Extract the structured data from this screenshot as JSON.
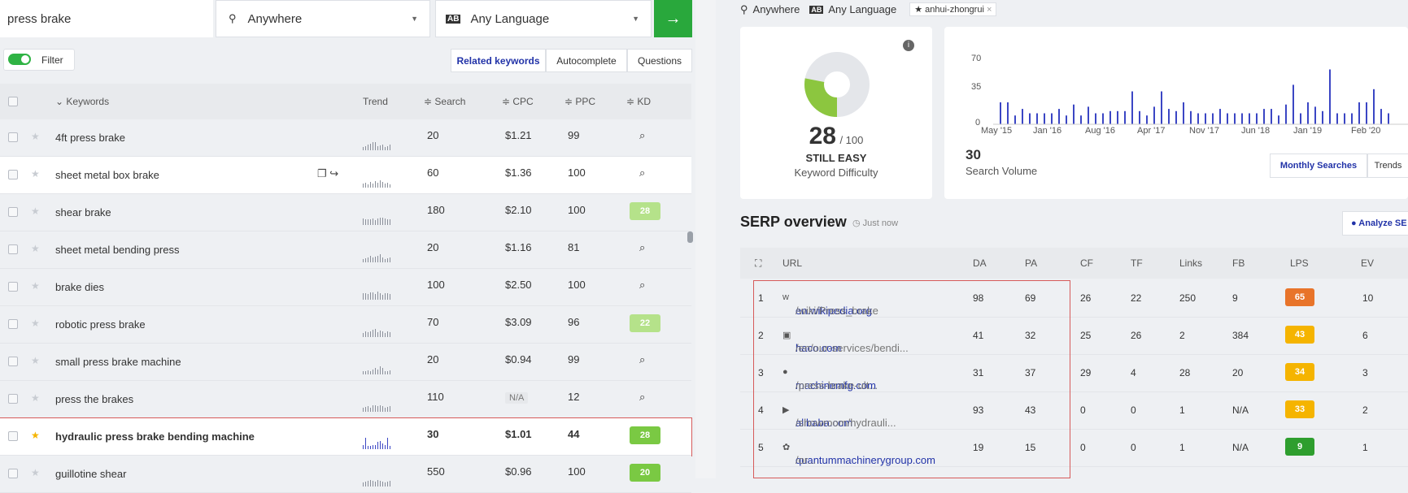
{
  "search": {
    "query": "press brake",
    "location": "Anywhere",
    "language": "Any Language",
    "go": "→"
  },
  "filter": {
    "label": "Filter"
  },
  "tabs": [
    "Related keywords",
    "Autocomplete",
    "Questions"
  ],
  "table": {
    "headers": {
      "keywords": "⌄ Keywords",
      "trend": "Trend",
      "search": "≑ Search",
      "cpc": "≑ CPC",
      "ppc": "≑ PPC",
      "kd": "≑ KD"
    },
    "rows": [
      {
        "kw": "4ft press brake",
        "search": "20",
        "cpc": "$1.21",
        "ppc": "99",
        "kd": ""
      },
      {
        "kw": "sheet metal box brake",
        "search": "60",
        "cpc": "$1.36",
        "ppc": "100",
        "kd": ""
      },
      {
        "kw": "shear brake",
        "search": "180",
        "cpc": "$2.10",
        "ppc": "100",
        "kd": "28"
      },
      {
        "kw": "sheet metal bending press",
        "search": "20",
        "cpc": "$1.16",
        "ppc": "81",
        "kd": ""
      },
      {
        "kw": "brake dies",
        "search": "100",
        "cpc": "$2.50",
        "ppc": "100",
        "kd": ""
      },
      {
        "kw": "robotic press brake",
        "search": "70",
        "cpc": "$3.09",
        "ppc": "96",
        "kd": "22"
      },
      {
        "kw": "small press brake machine",
        "search": "20",
        "cpc": "$0.94",
        "ppc": "99",
        "kd": ""
      },
      {
        "kw": "press the brakes",
        "search": "110",
        "cpc": "N/A",
        "ppc": "12",
        "kd": ""
      },
      {
        "kw": "hydraulic press brake bending machine",
        "search": "30",
        "cpc": "$1.01",
        "ppc": "44",
        "kd": "28"
      },
      {
        "kw": "guillotine shear",
        "search": "550",
        "cpc": "$0.96",
        "ppc": "100",
        "kd": "20"
      }
    ]
  },
  "right": {
    "filters": {
      "location": "Anywhere",
      "language": "Any Language",
      "tag": "anhui-zhongrui",
      "tag_close": "×"
    },
    "kd": {
      "value": "28",
      "max": "/ 100",
      "label": "STILL EASY",
      "sub": "Keyword Difficulty",
      "fraction": 0.28,
      "info": "i"
    },
    "volume": {
      "value": "30",
      "label": "Search Volume",
      "y_ticks": [
        "70",
        "35",
        "0"
      ],
      "x_ticks": [
        "May '15",
        "Jan '16",
        "Aug '16",
        "Apr '17",
        "Nov '17",
        "Jun '18",
        "Jan '19",
        "Feb '20"
      ],
      "tab_active": "Monthly Searches",
      "tab_other": "Trends"
    },
    "serp": {
      "title": "SERP overview",
      "time": "Just now",
      "analyze": "Analyze SE",
      "headers": [
        "URL",
        "DA",
        "PA",
        "CF",
        "TF",
        "Links",
        "FB",
        "LPS",
        "EV"
      ],
      "rows": [
        {
          "n": "1",
          "domain": "en.wikipedia.org",
          "path": "/wiki/Press_brake",
          "da": "98",
          "pa": "69",
          "cf": "26",
          "tf": "22",
          "links": "250",
          "fb": "9",
          "lps": "65",
          "ev": "10",
          "color": "#e8742a"
        },
        {
          "n": "2",
          "domain": "haco.com",
          "path": "/en/our-services/bendi...",
          "da": "41",
          "pa": "32",
          "cf": "25",
          "tf": "26",
          "links": "2",
          "fb": "384",
          "lps": "43",
          "ev": "6",
          "color": "#f5b400"
        },
        {
          "n": "3",
          "domain": "machinemfg.com",
          "path": "/press-brake-ult...",
          "da": "31",
          "pa": "37",
          "cf": "29",
          "tf": "4",
          "links": "28",
          "fb": "20",
          "lps": "34",
          "ev": "3",
          "color": "#f5b400"
        },
        {
          "n": "4",
          "domain": "alibaba.com",
          "path": "/showroom/hydrauli...",
          "da": "93",
          "pa": "43",
          "cf": "0",
          "tf": "0",
          "links": "1",
          "fb": "N/A",
          "lps": "33",
          "ev": "2",
          "color": "#f5b400"
        },
        {
          "n": "5",
          "domain": "quantummachinerygroup.com",
          "path": "/or...",
          "da": "19",
          "pa": "15",
          "cf": "0",
          "tf": "0",
          "links": "1",
          "fb": "N/A",
          "lps": "9",
          "ev": "1",
          "color": "#2e9e2e"
        }
      ]
    }
  },
  "colors": {
    "accent": "#2233a8",
    "go": "#29a83c",
    "kd_green": "#7ac943",
    "kd_light": "#b5e28a"
  }
}
